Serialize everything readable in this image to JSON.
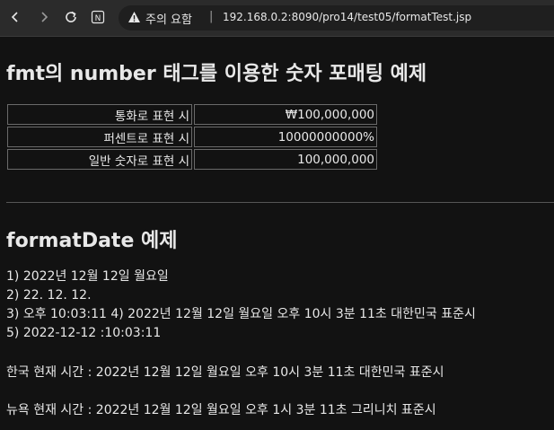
{
  "browser": {
    "security_label": "주의 요함",
    "separator": "|",
    "url": "192.168.0.2:8090/pro14/test05/formatTest.jsp",
    "reader_icon_letter": "N"
  },
  "page": {
    "title": "fmt의 number 태그를 이용한 숫자 포매팅 예제",
    "table": [
      {
        "label": "통화로 표현 시",
        "value": "₩100,000,000"
      },
      {
        "label": "퍼센트로 표현 시",
        "value": "10000000000%"
      },
      {
        "label": "일반 숫자로 표현 시",
        "value": "100,000,000"
      }
    ],
    "date_title": "formatDate 예제",
    "date_lines": [
      "1) 2022년 12월 12일 월요일",
      "2) 22. 12. 12.",
      "3) 오후 10:03:11 4) 2022년 12월 12일 월요일 오후 10시 3분 11초 대한민국 표준시",
      "5) 2022-12-12 :10:03:11"
    ],
    "korea_time": "한국 현재 시간 : 2022년 12월 12일 월요일 오후 10시 3분 11초 대한민국 표준시",
    "newyork_time": "뉴욕 현재 시간 : 2022년 12월 12일 월요일 오후 1시 3분 11초 그리니치 표준시"
  }
}
